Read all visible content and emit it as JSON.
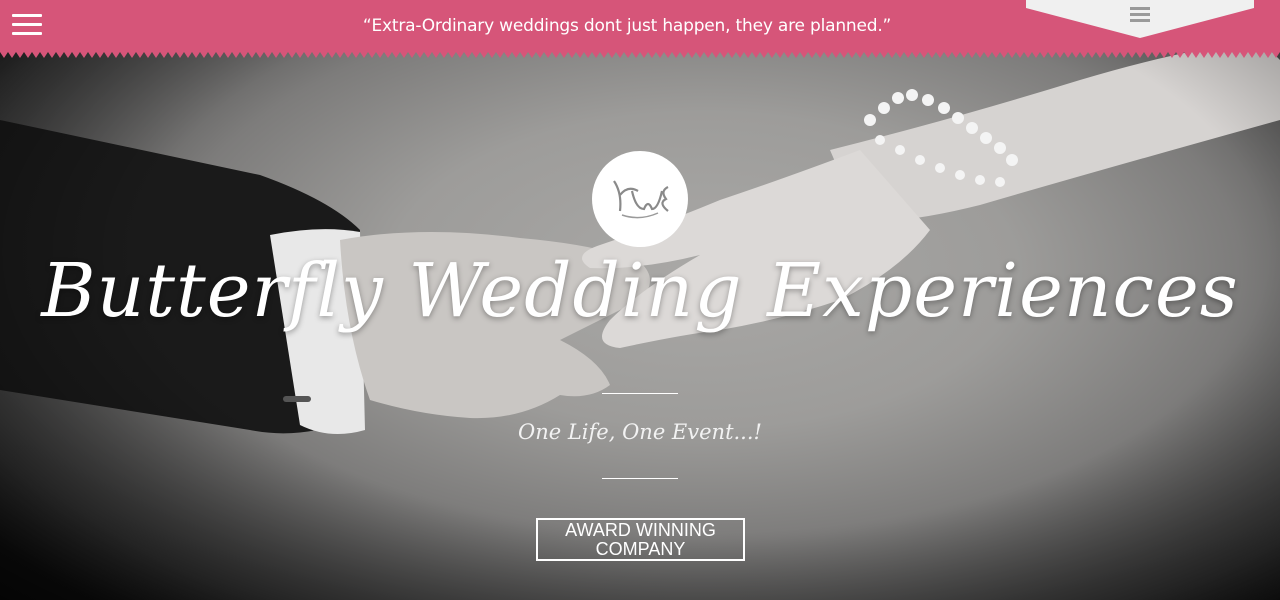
{
  "topbar": {
    "quote": "“Extra-Ordinary weddings dont just happen, they are planned.”",
    "menu_icon": "hamburger-menu-icon",
    "tab_icon": "hamburger-menu-icon",
    "background_color": "#d65579"
  },
  "hero": {
    "logo_text": "BWE",
    "title": "Butterfly Wedding Experiences",
    "tagline": "One Life, One Event...!",
    "button_line1": "AWARD WINNING",
    "button_line2": "COMPANY"
  }
}
